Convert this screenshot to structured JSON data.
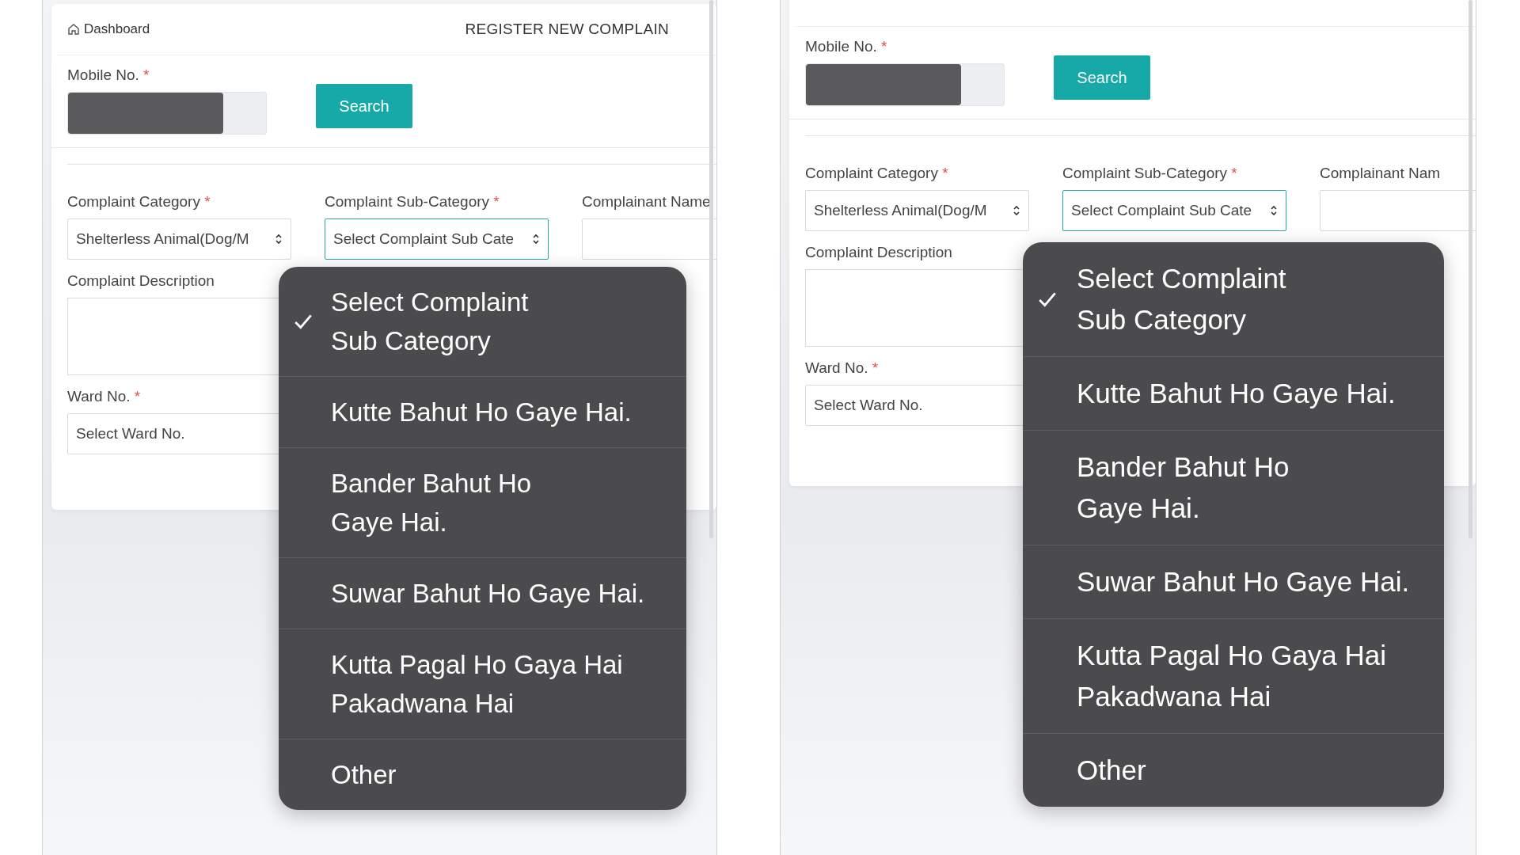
{
  "phones": [
    {
      "header": {
        "link": "Dashboard",
        "title": "REGISTER NEW COMPLAIN"
      },
      "mobile": {
        "label": "Mobile No.",
        "required_mark": "*"
      },
      "search_button": "Search",
      "fields": [
        {
          "label": "Complaint Category",
          "required_mark": "*",
          "value": "Shelterless Animal(Dog/M",
          "focused": false
        },
        {
          "label": "Complaint Sub-Category",
          "required_mark": "*",
          "value": "Select Complaint Sub Cate",
          "focused": true
        },
        {
          "label": "Complainant Name"
        }
      ],
      "description": {
        "label": "Complaint Description"
      },
      "ward": {
        "label": "Ward No.",
        "required_mark": "*",
        "value": "Select Ward No."
      },
      "menu": [
        {
          "label": "Select Complaint\nSub Category",
          "selected": true
        },
        {
          "label": "Kutte Bahut Ho Gaye Hai.",
          "selected": false
        },
        {
          "label": "Bander Bahut Ho\nGaye Hai.",
          "selected": false
        },
        {
          "label": "Suwar Bahut Ho Gaye Hai.",
          "selected": false
        },
        {
          "label": "Kutta Pagal Ho Gaya Hai\nPakadwana Hai",
          "selected": false
        },
        {
          "label": "Other",
          "selected": false
        }
      ]
    },
    {
      "mobile": {
        "label": "Mobile No.",
        "required_mark": "*"
      },
      "search_button": "Search",
      "fields": [
        {
          "label": "Complaint Category",
          "required_mark": "*",
          "value": "Shelterless Animal(Dog/M",
          "focused": false
        },
        {
          "label": "Complaint Sub-Category",
          "required_mark": "*",
          "value": "Select Complaint Sub Cate",
          "focused": true
        },
        {
          "label": "Complainant Nam"
        }
      ],
      "description": {
        "label": "Complaint Description"
      },
      "ward": {
        "label": "Ward No.",
        "required_mark": "*",
        "value": "Select Ward No."
      },
      "menu": [
        {
          "label": "Select Complaint\nSub Category",
          "selected": true
        },
        {
          "label": "Kutte Bahut Ho Gaye Hai.",
          "selected": false
        },
        {
          "label": "Bander Bahut Ho\nGaye Hai.",
          "selected": false
        },
        {
          "label": "Suwar Bahut Ho Gaye Hai.",
          "selected": false
        },
        {
          "label": "Kutta Pagal Ho Gaya Hai\nPakadwana Hai",
          "selected": false
        },
        {
          "label": "Other",
          "selected": false
        }
      ]
    }
  ]
}
